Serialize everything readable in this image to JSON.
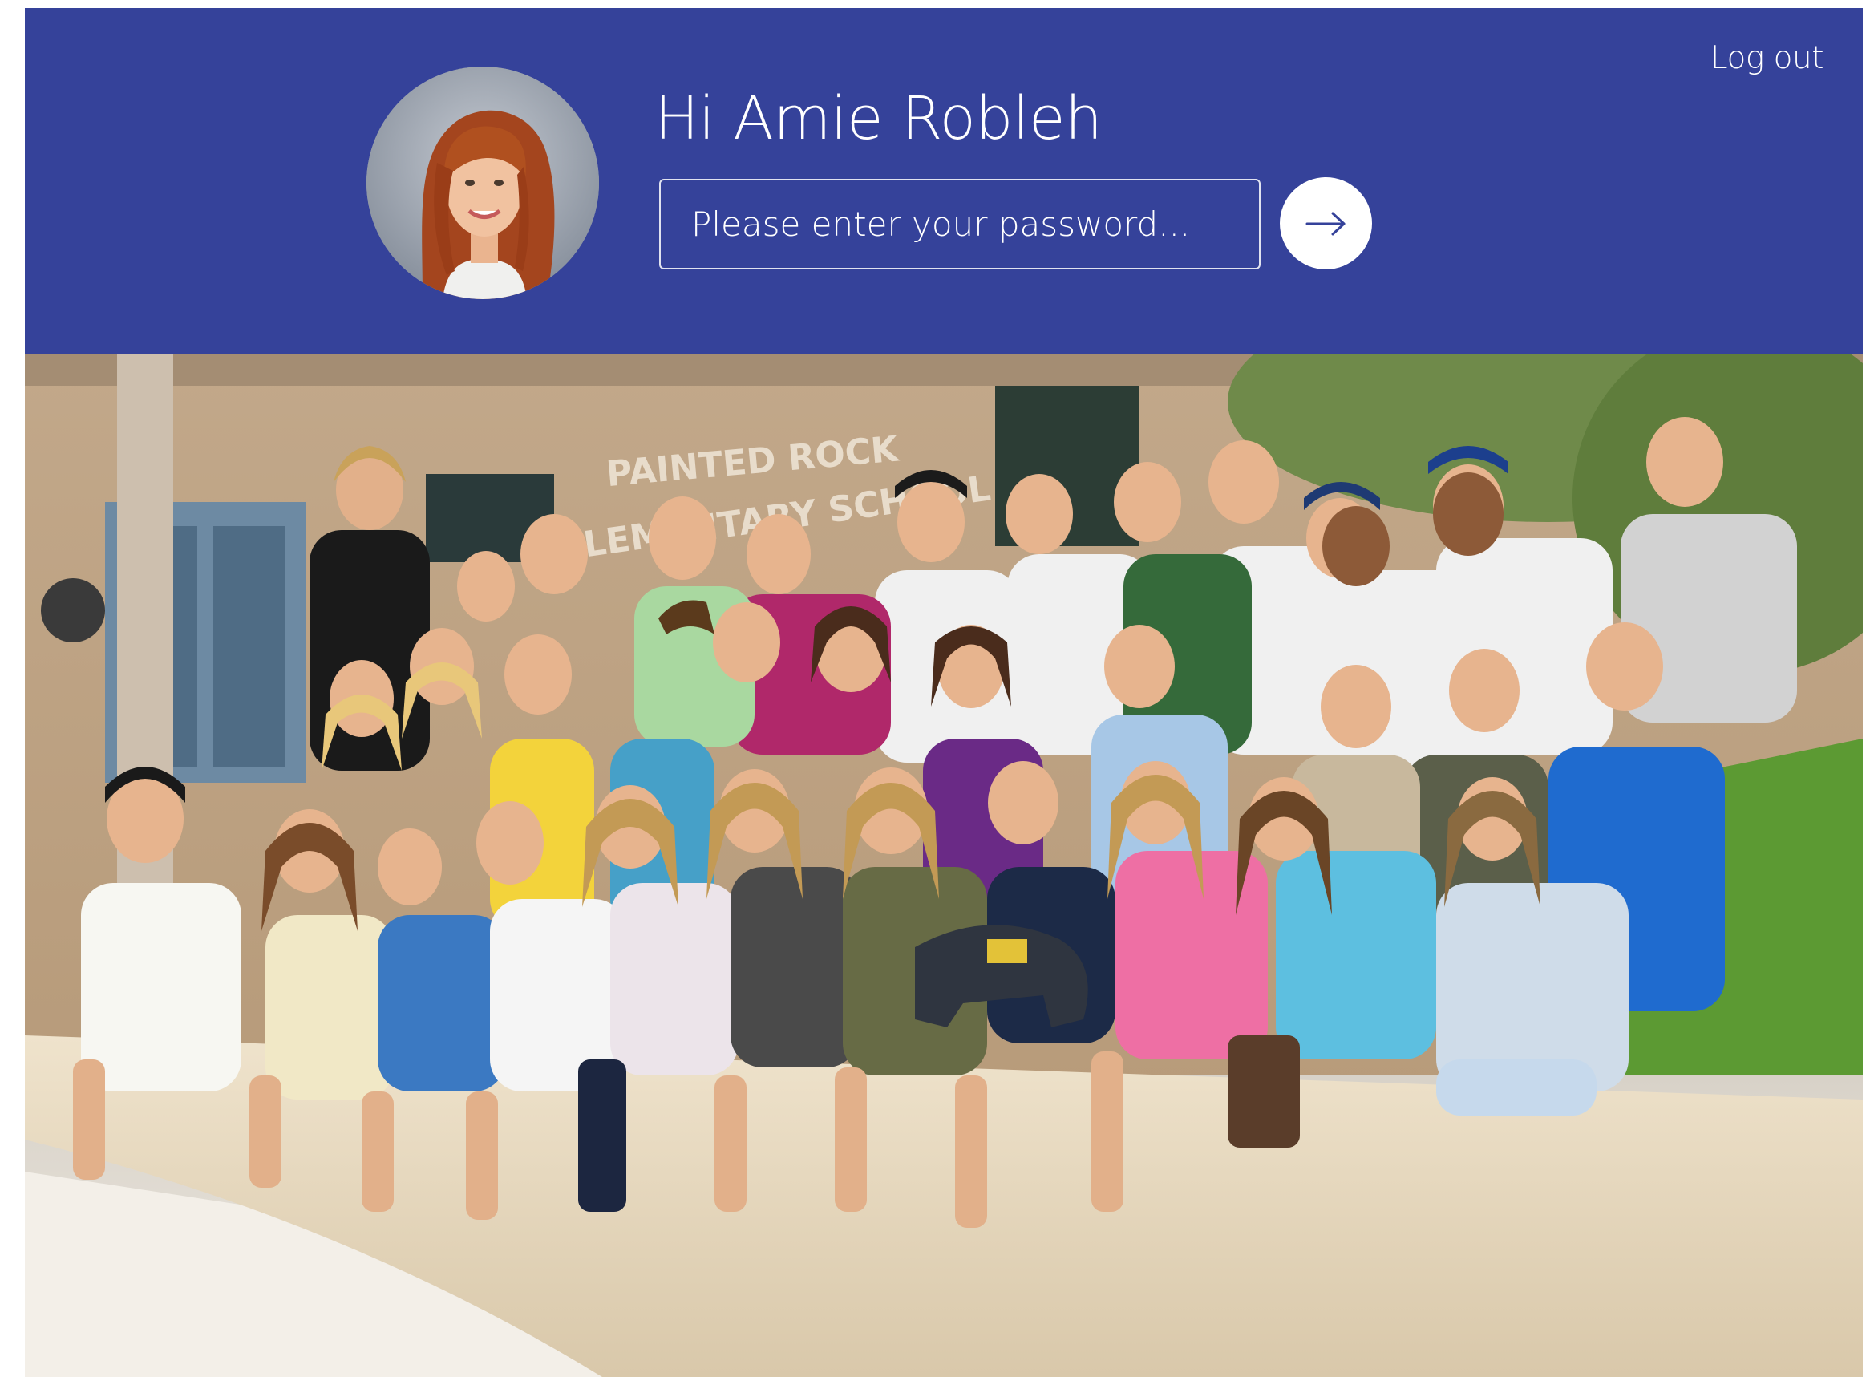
{
  "header": {
    "logout_label": "Log out",
    "greeting": "Hi Amie Robleh",
    "avatar_alt": "Amie Robleh profile photo"
  },
  "login": {
    "password_placeholder": "Please enter your password...",
    "submit_icon": "arrow-right-icon"
  },
  "photo": {
    "building_sign_line1": "PAINTED ROCK",
    "building_sign_line2": "ELEMENTARY SCHOOL",
    "description": "Class group photo in front of school"
  },
  "colors": {
    "header_bg": "#35429a",
    "text": "#ffffff",
    "button_bg": "#ffffff",
    "arrow": "#35429a"
  }
}
